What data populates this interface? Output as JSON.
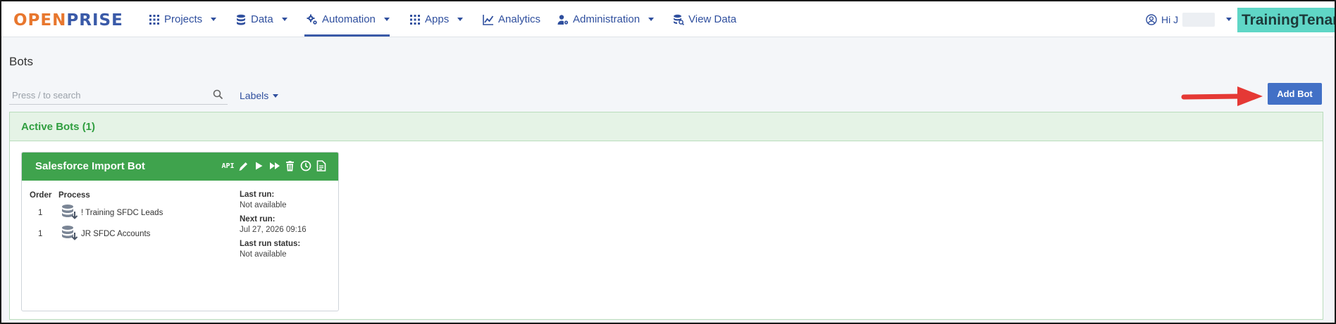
{
  "brand": {
    "open": "OPEN",
    "prise": "PRISE"
  },
  "nav": {
    "items": [
      {
        "label": "Projects",
        "icon": "grid-icon",
        "dropdown": true
      },
      {
        "label": "Data",
        "icon": "database-icon",
        "dropdown": true
      },
      {
        "label": "Automation",
        "icon": "cogs-icon",
        "dropdown": true,
        "active": true
      },
      {
        "label": "Apps",
        "icon": "grid-icon",
        "dropdown": true
      },
      {
        "label": "Analytics",
        "icon": "chart-line-icon",
        "dropdown": false
      },
      {
        "label": "Administration",
        "icon": "user-cog-icon",
        "dropdown": true
      },
      {
        "label": "View Data",
        "icon": "database-search-icon",
        "dropdown": false
      }
    ],
    "user_greeting": "Hi J",
    "tenant": "TrainingTenant"
  },
  "page": {
    "title": "Bots",
    "search_placeholder": "Press / to search",
    "labels_button": "Labels",
    "add_bot_button": "Add Bot"
  },
  "active_bots": {
    "header": "Active Bots (1)",
    "bots": [
      {
        "name": "Salesforce Import Bot",
        "actions": [
          "API",
          "edit-icon",
          "play-icon",
          "fast-forward-icon",
          "trash-icon",
          "clock-icon",
          "document-icon"
        ],
        "columns": {
          "order": "Order",
          "process": "Process"
        },
        "processes": [
          {
            "order": "1",
            "name": "! Training SFDC Leads"
          },
          {
            "order": "1",
            "name": "JR SFDC Accounts"
          }
        ],
        "meta": {
          "last_run_label": "Last run:",
          "last_run": "Not available",
          "next_run_label": "Next run:",
          "next_run": "Jul 27, 2026 09:16",
          "last_run_status_label": "Last run status:",
          "last_run_status": "Not available"
        }
      }
    ]
  },
  "colors": {
    "brand_orange": "#e8772e",
    "brand_blue": "#3a5aa8",
    "nav_text": "#2f4f9e",
    "tenant_bg": "#5fd6c6",
    "bot_header_green": "#3fa34d",
    "active_panel_bg": "#e5f3e6",
    "add_bot_blue": "#4270c6",
    "annotation_arrow_red": "#e53935"
  }
}
